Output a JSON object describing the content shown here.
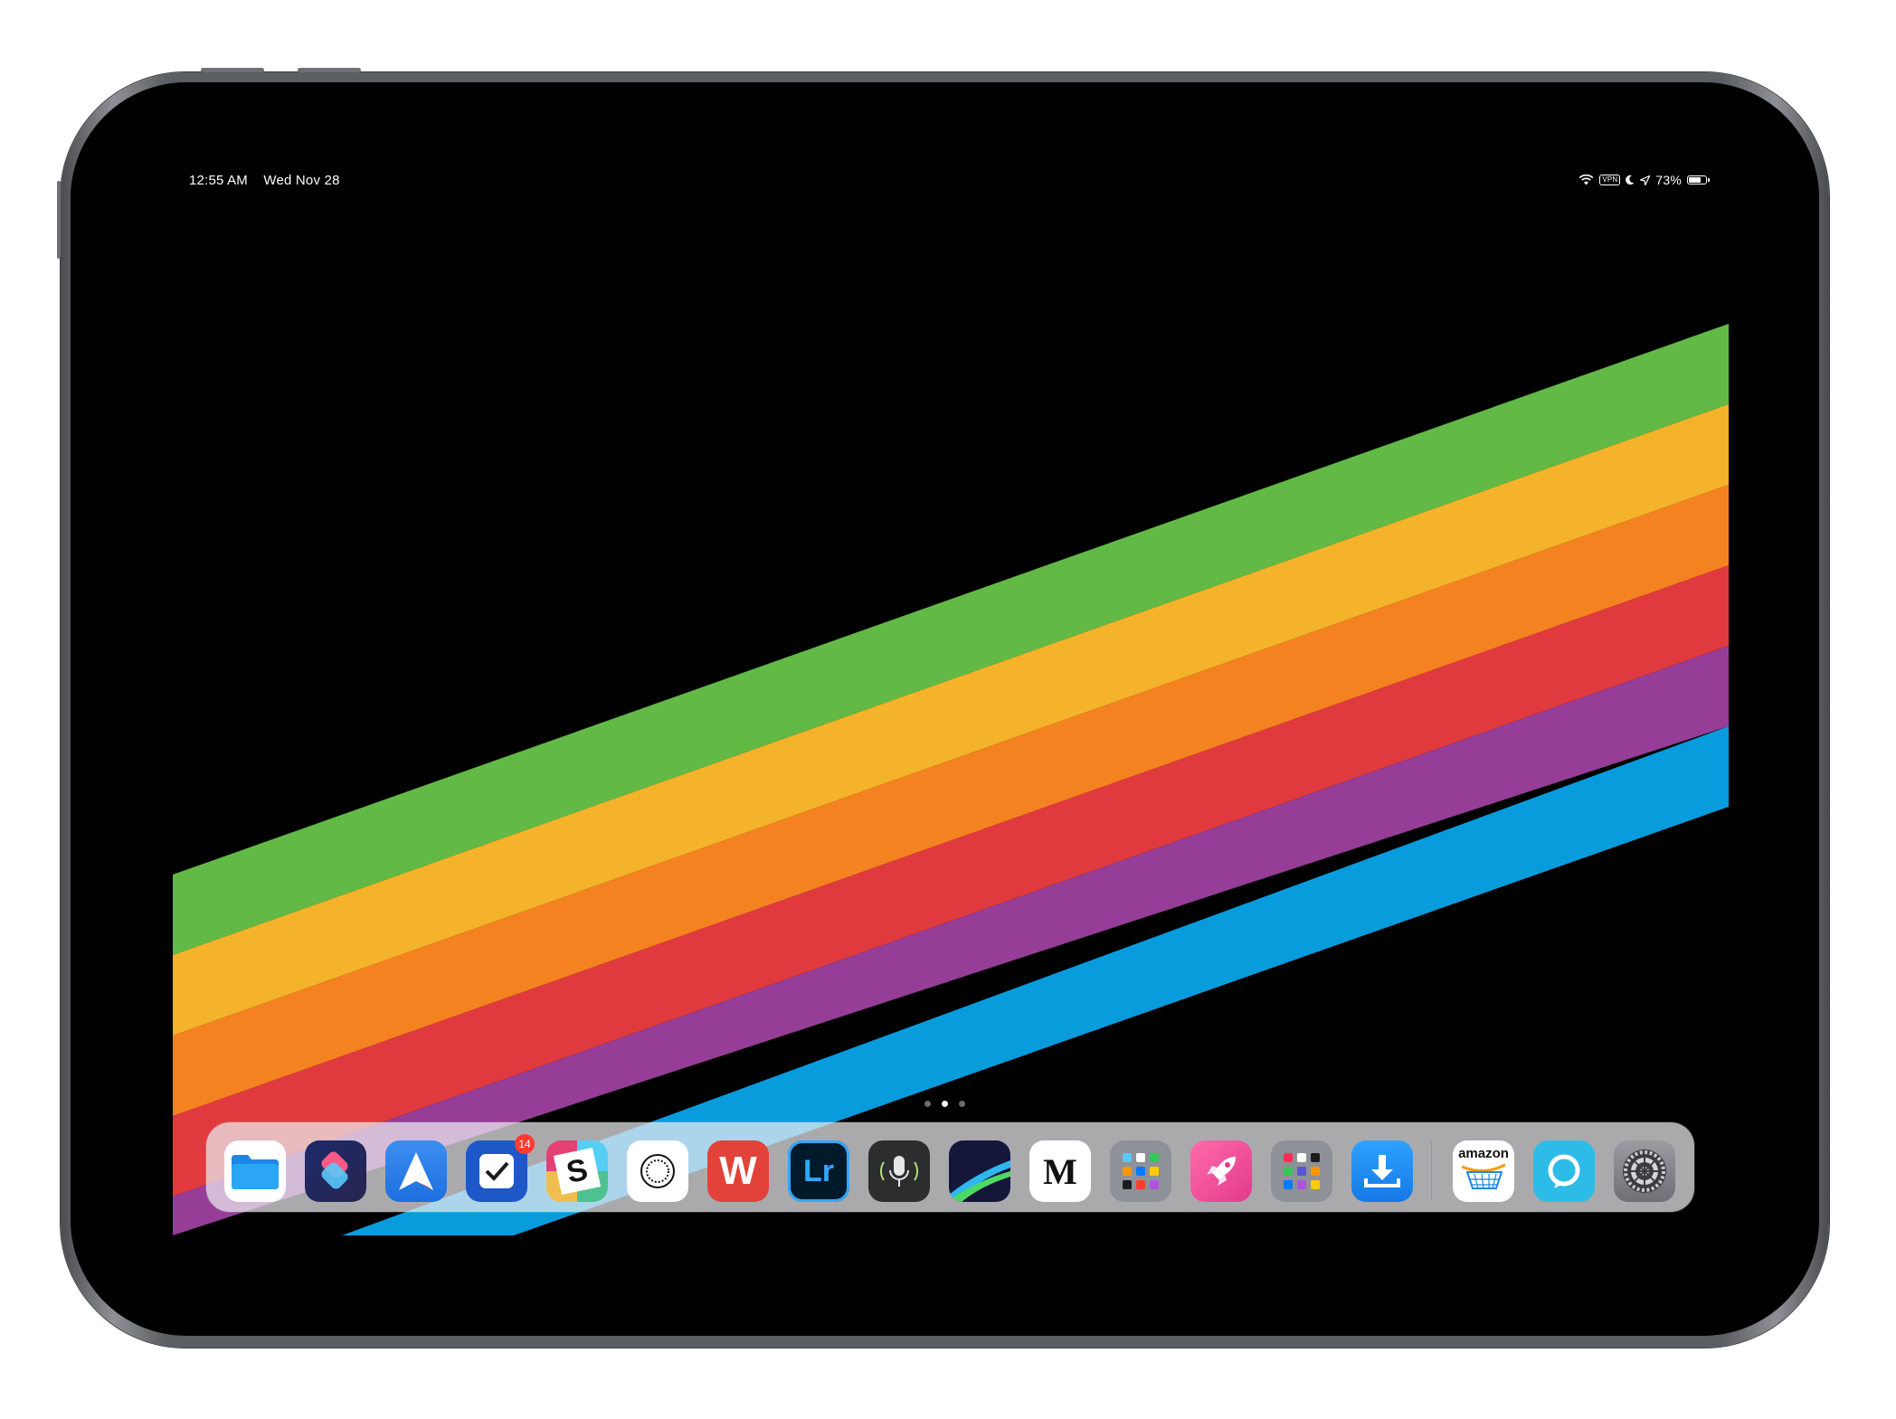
{
  "status_bar": {
    "time": "12:55 AM",
    "date": "Wed Nov 28",
    "vpn_label": "VPN",
    "battery_percent": "73%",
    "battery_level": 0.73,
    "icons": [
      "wifi-icon",
      "vpn-icon",
      "moon-icon",
      "location-arrow-icon",
      "battery-icon"
    ]
  },
  "wallpaper": {
    "stripe_colors": [
      "#62b946",
      "#f4b32a",
      "#f58220",
      "#e03a3e",
      "#963d97",
      "#089cdd"
    ]
  },
  "page_dots": {
    "count": 3,
    "active_index": 1
  },
  "dock": {
    "apps": [
      {
        "name": "files-app",
        "icon": "folder-icon",
        "label": ""
      },
      {
        "name": "shortcuts-app",
        "icon": "shortcuts-icon",
        "label": ""
      },
      {
        "name": "spark-app",
        "icon": "paper-plane-icon",
        "label": ""
      },
      {
        "name": "omnifocus-app",
        "icon": "checkbox-icon",
        "label": "",
        "badge": "14"
      },
      {
        "name": "slack-app",
        "icon": "slack-s-icon",
        "label": "S"
      },
      {
        "name": "vsco-app",
        "icon": "vsco-ring-icon",
        "label": ""
      },
      {
        "name": "word-app",
        "icon": "word-w-icon",
        "label": "W"
      },
      {
        "name": "lightroom-app",
        "icon": "lightroom-icon",
        "label": "Lr"
      },
      {
        "name": "podcast-app",
        "icon": "microphone-icon",
        "label": ""
      },
      {
        "name": "luma-app",
        "icon": "swoosh-icon",
        "label": ""
      },
      {
        "name": "medium-app",
        "icon": "medium-m-icon",
        "label": "M"
      },
      {
        "name": "folder-one",
        "icon": "app-folder-icon",
        "label": ""
      },
      {
        "name": "launch-app",
        "icon": "rocket-icon",
        "label": ""
      },
      {
        "name": "folder-two",
        "icon": "app-folder-icon",
        "label": ""
      },
      {
        "name": "downloader-app",
        "icon": "download-icon",
        "label": ""
      },
      {
        "name": "amazon-app",
        "icon": "amazon-cart-icon",
        "label": "amazon"
      },
      {
        "name": "alexa-app",
        "icon": "alexa-ring-icon",
        "label": ""
      },
      {
        "name": "settings-app",
        "icon": "gear-icon",
        "label": ""
      }
    ]
  }
}
